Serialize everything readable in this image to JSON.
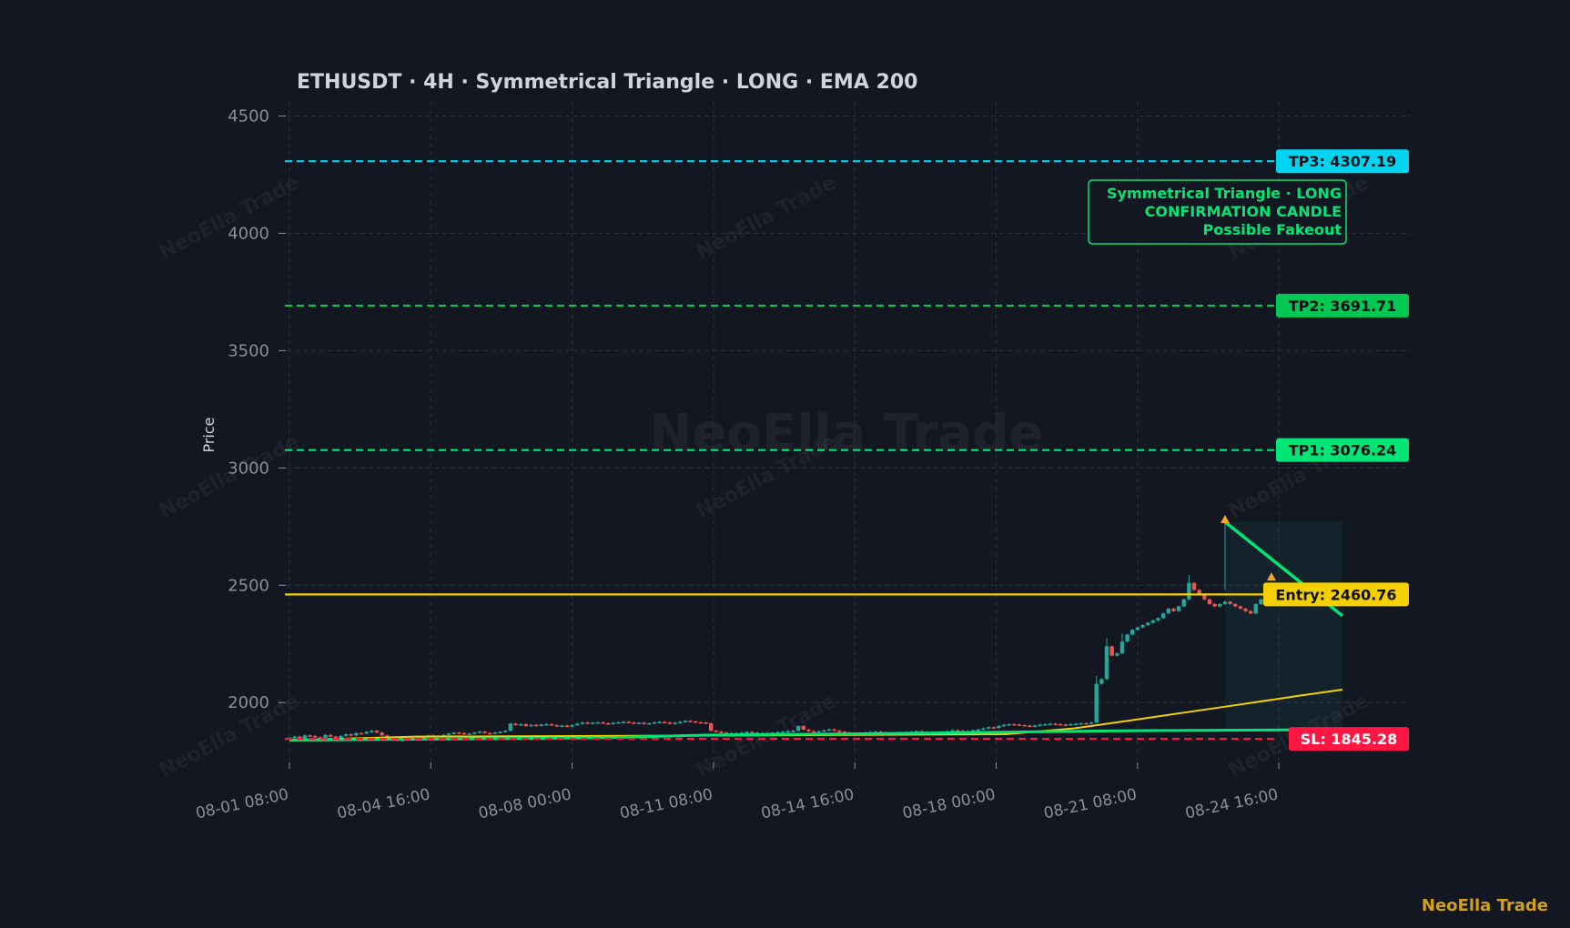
{
  "chart_data": {
    "type": "candlestick",
    "title": "ETHUSDT  ·  4H  ·  Symmetrical Triangle  ·  LONG  ·  EMA 200",
    "xlabel": "",
    "ylabel": "Price",
    "ylim": [
      1745,
      4560
    ],
    "y_ticks": [
      2000,
      2500,
      3000,
      3500,
      4000,
      4500
    ],
    "x_ticks": [
      "08-01 08:00",
      "08-04 16:00",
      "08-08 00:00",
      "08-11 08:00",
      "08-14 16:00",
      "08-18 00:00",
      "08-21 08:00",
      "08-24 16:00"
    ],
    "grid": true,
    "levels": [
      {
        "name": "TP3",
        "label": "TP3: 4307.19",
        "value": 4307.19,
        "color": "#00d4f0",
        "style": "dashed"
      },
      {
        "name": "TP2",
        "label": "TP2: 3691.71",
        "value": 3691.71,
        "color": "#00c853",
        "style": "dashed"
      },
      {
        "name": "TP1",
        "label": "TP1: 3076.24",
        "value": 3076.24,
        "color": "#00e676",
        "style": "dashed"
      },
      {
        "name": "Entry",
        "label": "Entry: 2460.76",
        "value": 2460.76,
        "color": "#f5d000",
        "style": "solid"
      },
      {
        "name": "SL",
        "label": "SL: 1845.28",
        "value": 1845.28,
        "color": "#ff1744",
        "style": "dashed"
      }
    ],
    "pattern_box": {
      "lines": [
        "Symmetrical Triangle · LONG",
        "CONFIRMATION CANDLE",
        "Possible Fakeout"
      ],
      "color": "#00e676"
    },
    "candles_close": [
      1850,
      1855,
      1845,
      1860,
      1858,
      1852,
      1848,
      1862,
      1855,
      1850,
      1858,
      1865,
      1860,
      1870,
      1868,
      1875,
      1880,
      1872,
      1860,
      1850,
      1845,
      1838,
      1842,
      1850,
      1848,
      1855,
      1852,
      1860,
      1858,
      1856,
      1862,
      1868,
      1872,
      1870,
      1866,
      1868,
      1872,
      1876,
      1870,
      1868,
      1872,
      1875,
      1880,
      1910,
      1905,
      1908,
      1900,
      1905,
      1902,
      1906,
      1908,
      1904,
      1900,
      1902,
      1898,
      1904,
      1910,
      1915,
      1912,
      1914,
      1916,
      1912,
      1910,
      1914,
      1916,
      1918,
      1915,
      1912,
      1914,
      1910,
      1912,
      1916,
      1918,
      1915,
      1910,
      1914,
      1918,
      1922,
      1920,
      1916,
      1915,
      1912,
      1880,
      1876,
      1872,
      1870,
      1868,
      1870,
      1872,
      1875,
      1872,
      1870,
      1868,
      1870,
      1872,
      1874,
      1876,
      1878,
      1880,
      1900,
      1885,
      1878,
      1875,
      1878,
      1882,
      1886,
      1880,
      1876,
      1872,
      1870,
      1868,
      1870,
      1872,
      1874,
      1876,
      1872,
      1870,
      1868,
      1870,
      1872,
      1874,
      1876,
      1878,
      1875,
      1872,
      1870,
      1872,
      1875,
      1878,
      1882,
      1880,
      1876,
      1878,
      1882,
      1885,
      1890,
      1895,
      1892,
      1900,
      1905,
      1908,
      1906,
      1904,
      1902,
      1898,
      1902,
      1906,
      1908,
      1910,
      1908,
      1906,
      1905,
      1908,
      1910,
      1912,
      1910,
      1915,
      2080,
      2100,
      2240,
      2200,
      2210,
      2260,
      2290,
      2310,
      2320,
      2330,
      2340,
      2350,
      2360,
      2380,
      2400,
      2390,
      2410,
      2440,
      2510,
      2480,
      2460,
      2440,
      2420,
      2410,
      2420,
      2430,
      2420,
      2410,
      2400,
      2390,
      2380,
      2420,
      2440,
      2450,
      2460,
      2440,
      2450,
      2460,
      2470,
      2450
    ],
    "candles_open_first": 1848,
    "ema200": [
      [
        0,
        1840
      ],
      [
        120,
        1855
      ],
      [
        420,
        1860
      ],
      [
        680,
        1865
      ],
      [
        745,
        1890
      ],
      [
        800,
        1925
      ],
      [
        900,
        1990
      ],
      [
        960,
        2030
      ],
      [
        1000,
        2055
      ]
    ],
    "ema_slow": [
      [
        0,
        1840
      ],
      [
        300,
        1850
      ],
      [
        400,
        1862
      ],
      [
        520,
        1866
      ],
      [
        640,
        1872
      ],
      [
        800,
        1880
      ],
      [
        1000,
        1885
      ]
    ],
    "triangle": {
      "upper": [
        [
          2.0,
          2770
        ],
        [
          3.52,
          2370
        ]
      ],
      "marker_top": 2770,
      "marker_mid": 2525,
      "shade_start_index": 182
    }
  }
}
